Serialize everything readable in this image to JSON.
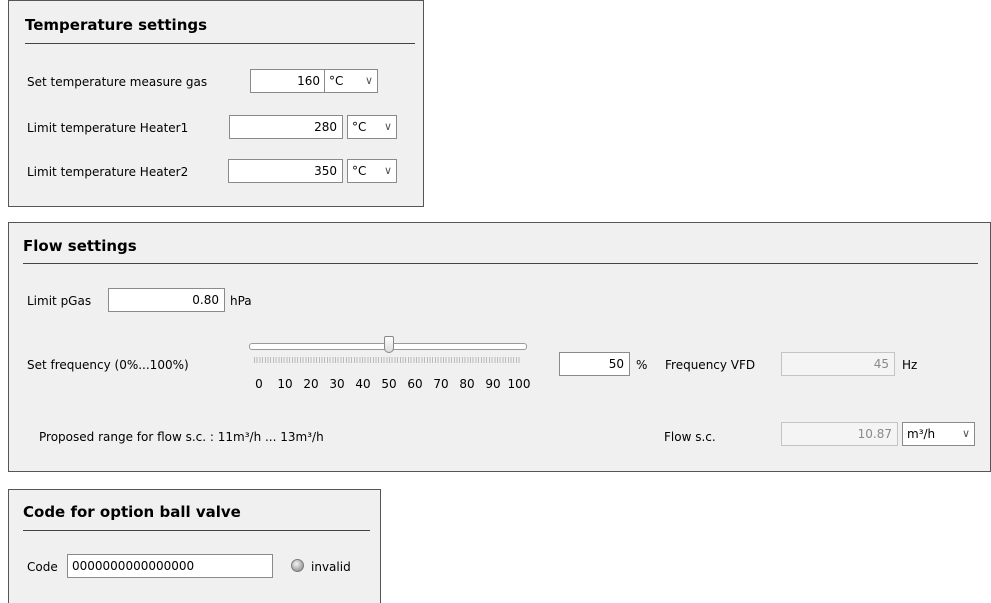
{
  "temperature": {
    "title": "Temperature settings",
    "rows": [
      {
        "label": "Set temperature measure gas",
        "value": "160",
        "unit": "°C"
      },
      {
        "label": "Limit temperature Heater1",
        "value": "280",
        "unit": "°C"
      },
      {
        "label": "Limit temperature Heater2",
        "value": "350",
        "unit": "°C"
      }
    ]
  },
  "flow": {
    "title": "Flow settings",
    "limit_pgas": {
      "label": "Limit pGas",
      "value": "0.80",
      "unit": "hPa"
    },
    "frequency": {
      "label": "Set frequency (0%...100%)",
      "slider_value": 50,
      "scale": [
        "0",
        "10",
        "20",
        "30",
        "40",
        "50",
        "60",
        "70",
        "80",
        "90",
        "100"
      ],
      "value": "50",
      "unit": "%"
    },
    "frequency_vfd": {
      "label": "Frequency VFD",
      "value": "45",
      "unit": "Hz"
    },
    "proposed_range": "Proposed range for flow s.c. : 11m³/h ... 13m³/h",
    "flow_sc": {
      "label": "Flow s.c.",
      "value": "10.87",
      "unit": "m³/h"
    }
  },
  "ball_valve": {
    "title": "Code for option ball valve",
    "code_label": "Code",
    "code_value": "0000000000000000",
    "status": "invalid"
  },
  "icons": {
    "dropdown": "chevron-down-icon",
    "status": "status-led-icon"
  }
}
